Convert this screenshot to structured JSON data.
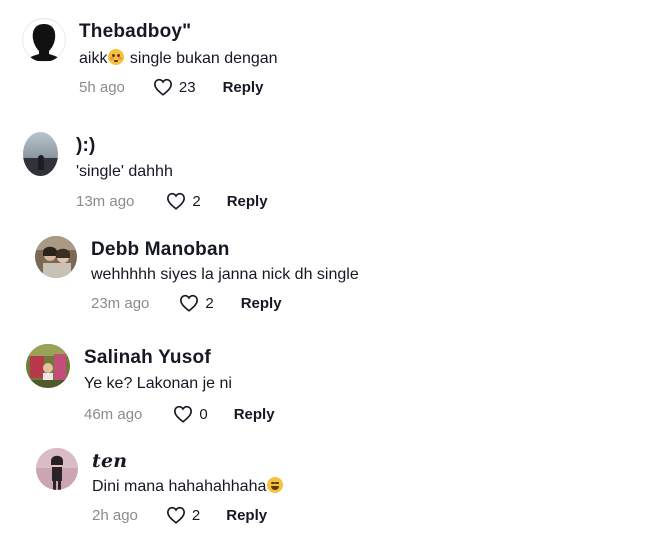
{
  "comments": [
    {
      "username": "Thebadboy\"",
      "text_before": "aikk",
      "emoji": "flushed-face-emoji",
      "text_after": " single bukan dengan",
      "time": "5h ago",
      "likes": "23",
      "reply": "Reply"
    },
    {
      "username": "):)",
      "text": "'single' dahhh",
      "time": "13m ago",
      "likes": "2",
      "reply": "Reply"
    },
    {
      "username": "Debb Manoban",
      "text": "wehhhhh siyes la janna nick dh single",
      "time": "23m ago",
      "likes": "2",
      "reply": "Reply"
    },
    {
      "username": "Salinah Yusof",
      "text": "Ye ke? Lakonan je ni",
      "time": "46m ago",
      "likes": "0",
      "reply": "Reply"
    },
    {
      "username": "𝒕𝒆𝒏",
      "text_before": "Dini mana hahahahhaha",
      "emoji": "tears-of-joy-emoji",
      "time": "2h ago",
      "likes": "2",
      "reply": "Reply"
    }
  ],
  "colors": {
    "text": "#161823",
    "secondary": "#8a8b91",
    "background": "#ffffff"
  },
  "icons": {
    "like": "heart-outline-icon"
  }
}
